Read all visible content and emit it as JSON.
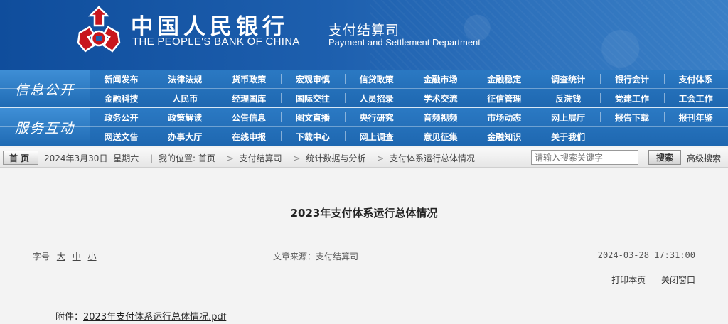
{
  "header": {
    "bank_name_cn": "中国人民银行",
    "bank_name_en": "THE PEOPLE'S BANK OF CHINA",
    "dept_cn": "支付结算司",
    "dept_en": "Payment and Settlement Department",
    "logo_icon": "pboc-logo-icon",
    "colors": {
      "banner": "#1d5fae",
      "logo": "#c8161d"
    }
  },
  "nav": {
    "group1_title": "信息公开",
    "group1_row1": [
      "新闻发布",
      "法律法规",
      "货币政策",
      "宏观审慎",
      "信贷政策",
      "金融市场",
      "金融稳定",
      "调查统计",
      "银行会计",
      "支付体系"
    ],
    "group1_row2": [
      "金融科技",
      "人民币",
      "经理国库",
      "国际交往",
      "人员招录",
      "学术交流",
      "征信管理",
      "反洗钱",
      "党建工作",
      "工会工作"
    ],
    "group2_title": "服务互动",
    "group2_row1": [
      "政务公开",
      "政策解读",
      "公告信息",
      "图文直播",
      "央行研究",
      "音频视频",
      "市场动态",
      "网上展厅",
      "报告下载",
      "报刊年鉴"
    ],
    "group2_row2": [
      "网送文告",
      "办事大厅",
      "在线申报",
      "下载中心",
      "网上调查",
      "意见征集",
      "金融知识",
      "关于我们"
    ]
  },
  "breadcrumb": {
    "home_label": "首页",
    "date": "2024年3月30日",
    "weekday": "星期六",
    "sep": "|",
    "location_label": "我的位置: 首页",
    "arrow": ">",
    "level1": "支付结算司",
    "level2": "统计数据与分析",
    "level3": "支付体系运行总体情况"
  },
  "search": {
    "placeholder": "请输入搜索关键字",
    "button_label": "搜索",
    "advanced_label": "高级搜索"
  },
  "article": {
    "title": "2023年支付体系运行总体情况",
    "fontsize_label": "字号",
    "fontsize_large": "大",
    "fontsize_medium": "中",
    "fontsize_small": "小",
    "source": "文章来源：支付结算司",
    "date": "2024-03-28 17:31:00",
    "print_label": "打印本页",
    "close_label": "关闭窗口",
    "attachment_label": "附件：",
    "attachment_file": "2023年支付体系运行总体情况.pdf"
  }
}
